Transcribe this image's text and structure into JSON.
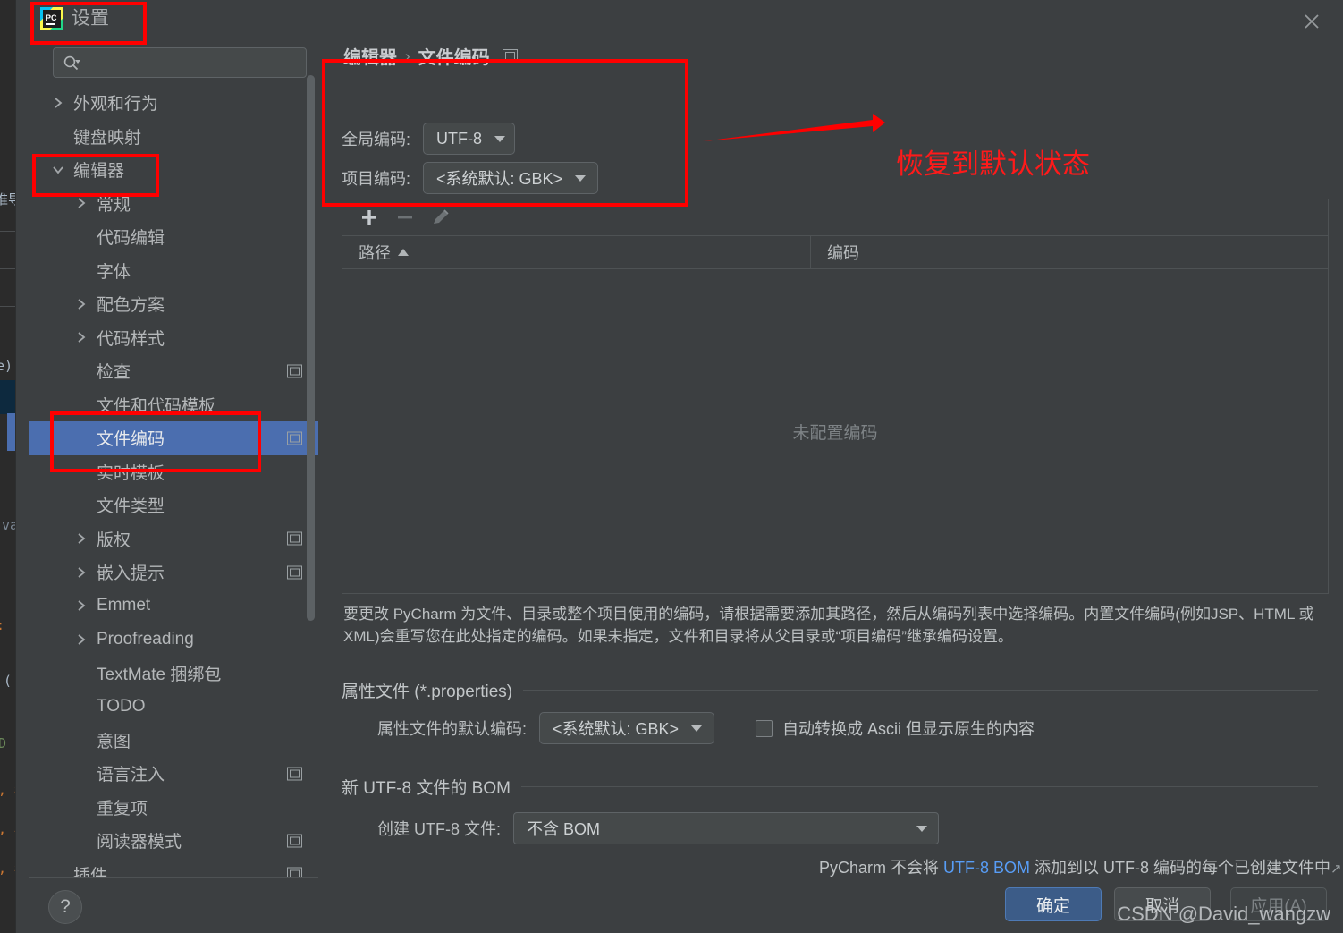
{
  "window": {
    "title": "设置",
    "app_icon": "pycharm-icon",
    "close_icon": "close-icon"
  },
  "search": {
    "placeholder": "",
    "value": "",
    "icon": "search-icon"
  },
  "sidebar": {
    "items": [
      {
        "label": "外观和行为",
        "indent": 0,
        "twisty": "chevron-right",
        "badge": false,
        "selected": false
      },
      {
        "label": "键盘映射",
        "indent": 0,
        "twisty": "none",
        "badge": false,
        "selected": false
      },
      {
        "label": "编辑器",
        "indent": 0,
        "twisty": "chevron-down",
        "badge": false,
        "selected": false
      },
      {
        "label": "常规",
        "indent": 1,
        "twisty": "chevron-right",
        "badge": false,
        "selected": false
      },
      {
        "label": "代码编辑",
        "indent": 1,
        "twisty": "none",
        "badge": false,
        "selected": false
      },
      {
        "label": "字体",
        "indent": 1,
        "twisty": "none",
        "badge": false,
        "selected": false
      },
      {
        "label": "配色方案",
        "indent": 1,
        "twisty": "chevron-right",
        "badge": false,
        "selected": false
      },
      {
        "label": "代码样式",
        "indent": 1,
        "twisty": "chevron-right",
        "badge": false,
        "selected": false
      },
      {
        "label": "检查",
        "indent": 1,
        "twisty": "none",
        "badge": true,
        "selected": false
      },
      {
        "label": "文件和代码模板",
        "indent": 1,
        "twisty": "none",
        "badge": false,
        "selected": false
      },
      {
        "label": "文件编码",
        "indent": 1,
        "twisty": "none",
        "badge": true,
        "selected": true
      },
      {
        "label": "实时模板",
        "indent": 1,
        "twisty": "none",
        "badge": false,
        "selected": false
      },
      {
        "label": "文件类型",
        "indent": 1,
        "twisty": "none",
        "badge": false,
        "selected": false
      },
      {
        "label": "版权",
        "indent": 1,
        "twisty": "chevron-right",
        "badge": true,
        "selected": false
      },
      {
        "label": "嵌入提示",
        "indent": 1,
        "twisty": "chevron-right",
        "badge": true,
        "selected": false
      },
      {
        "label": "Emmet",
        "indent": 1,
        "twisty": "chevron-right",
        "badge": false,
        "selected": false
      },
      {
        "label": "Proofreading",
        "indent": 1,
        "twisty": "chevron-right",
        "badge": false,
        "selected": false
      },
      {
        "label": "TextMate 捆绑包",
        "indent": 1,
        "twisty": "none",
        "badge": false,
        "selected": false
      },
      {
        "label": "TODO",
        "indent": 1,
        "twisty": "none",
        "badge": false,
        "selected": false
      },
      {
        "label": "意图",
        "indent": 1,
        "twisty": "none",
        "badge": false,
        "selected": false
      },
      {
        "label": "语言注入",
        "indent": 1,
        "twisty": "none",
        "badge": true,
        "selected": false
      },
      {
        "label": "重复项",
        "indent": 1,
        "twisty": "none",
        "badge": false,
        "selected": false
      },
      {
        "label": "阅读器模式",
        "indent": 1,
        "twisty": "none",
        "badge": true,
        "selected": false
      },
      {
        "label": "插件",
        "indent": 0,
        "twisty": "none",
        "badge": true,
        "selected": false
      }
    ]
  },
  "content": {
    "breadcrumb": {
      "parent": "编辑器",
      "separator": "›",
      "current": "文件编码"
    },
    "global_encoding": {
      "label": "全局编码:",
      "value": "UTF-8"
    },
    "project_encoding": {
      "label": "项目编码:",
      "value": "<系统默认: GBK>"
    },
    "toolbar": {
      "add_icon": "plus-icon",
      "remove_icon": "minus-icon",
      "edit_icon": "pencil-icon"
    },
    "table": {
      "columns": [
        "路径",
        "编码"
      ],
      "sort_indicator": "▲",
      "rows": [],
      "empty_text": "未配置编码"
    },
    "description": "要更改 PyCharm 为文件、目录或整个项目使用的编码，请根据需要添加其路径，然后从编码列表中选择编码。内置文件编码(例如JSP、HTML 或 XML)会重写您在此处指定的编码。如果未指定，文件和目录将从父目录或“项目编码”继承编码设置。",
    "properties_section": {
      "title": "属性文件 (*.properties)",
      "default_encoding_label": "属性文件的默认编码:",
      "default_encoding_value": "<系统默认: GBK>",
      "ascii_checkbox_label": "自动转换成 Ascii 但显示原生的内容",
      "ascii_checked": false
    },
    "bom_section": {
      "title": "新 UTF-8 文件的 BOM",
      "create_label": "创建 UTF-8 文件:",
      "create_value": "不含 BOM",
      "hint_prefix": "PyCharm 不会将 ",
      "hint_link": "UTF-8 BOM",
      "hint_suffix": " 添加到以 UTF-8 编码的每个已创建文件中",
      "hint_external_icon": "↗"
    }
  },
  "footer": {
    "help_label": "?",
    "ok_label": "确定",
    "cancel_label": "取消",
    "apply_label": "应用(A)"
  },
  "annotations": {
    "arrow_note": "恢复到默认状态",
    "highlight_color": "#ff0000",
    "note_color": "#ff1a1a"
  },
  "watermark": {
    "text": "CSDN @David_wangzw"
  },
  "background": {
    "editor_fragments": [
      "推导",
      "e)",
      "valu",
      ":",
      "(",
      "D :",
      ", 年",
      ", 年",
      ", 年"
    ]
  }
}
